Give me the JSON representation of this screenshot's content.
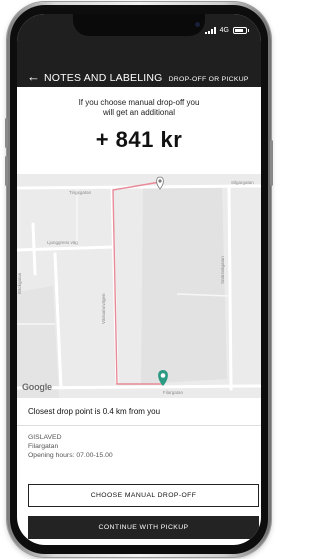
{
  "status_bar": {
    "network": "4G"
  },
  "header": {
    "title": "NOTES AND LABELING",
    "subtitle": "DROP-OFF OR PICKUP",
    "back_icon": "arrow-left-icon"
  },
  "info": {
    "line1": "If you choose manual drop-off you",
    "line2": "will get an additional",
    "amount": "+ 841 kr"
  },
  "map": {
    "streets": [
      "Tingsgatan",
      "Silgargatan",
      "Ljunggrens väg",
      "Bäckgatan",
      "Värnamovägen",
      "Snärsvägatan",
      "Filargatan"
    ],
    "attribution": "Google",
    "route_color": "#e88a98",
    "marker_color": "#2c9a83"
  },
  "drop_point": {
    "summary": "Closest drop point is 0.4 km from you",
    "name": "GISLAVED",
    "street": "Filargatan",
    "hours": "Opening hours: 07.00-15.00"
  },
  "buttons": {
    "manual": "CHOOSE MANUAL DROP-OFF",
    "pickup": "CONTINUE WITH PICKUP"
  }
}
